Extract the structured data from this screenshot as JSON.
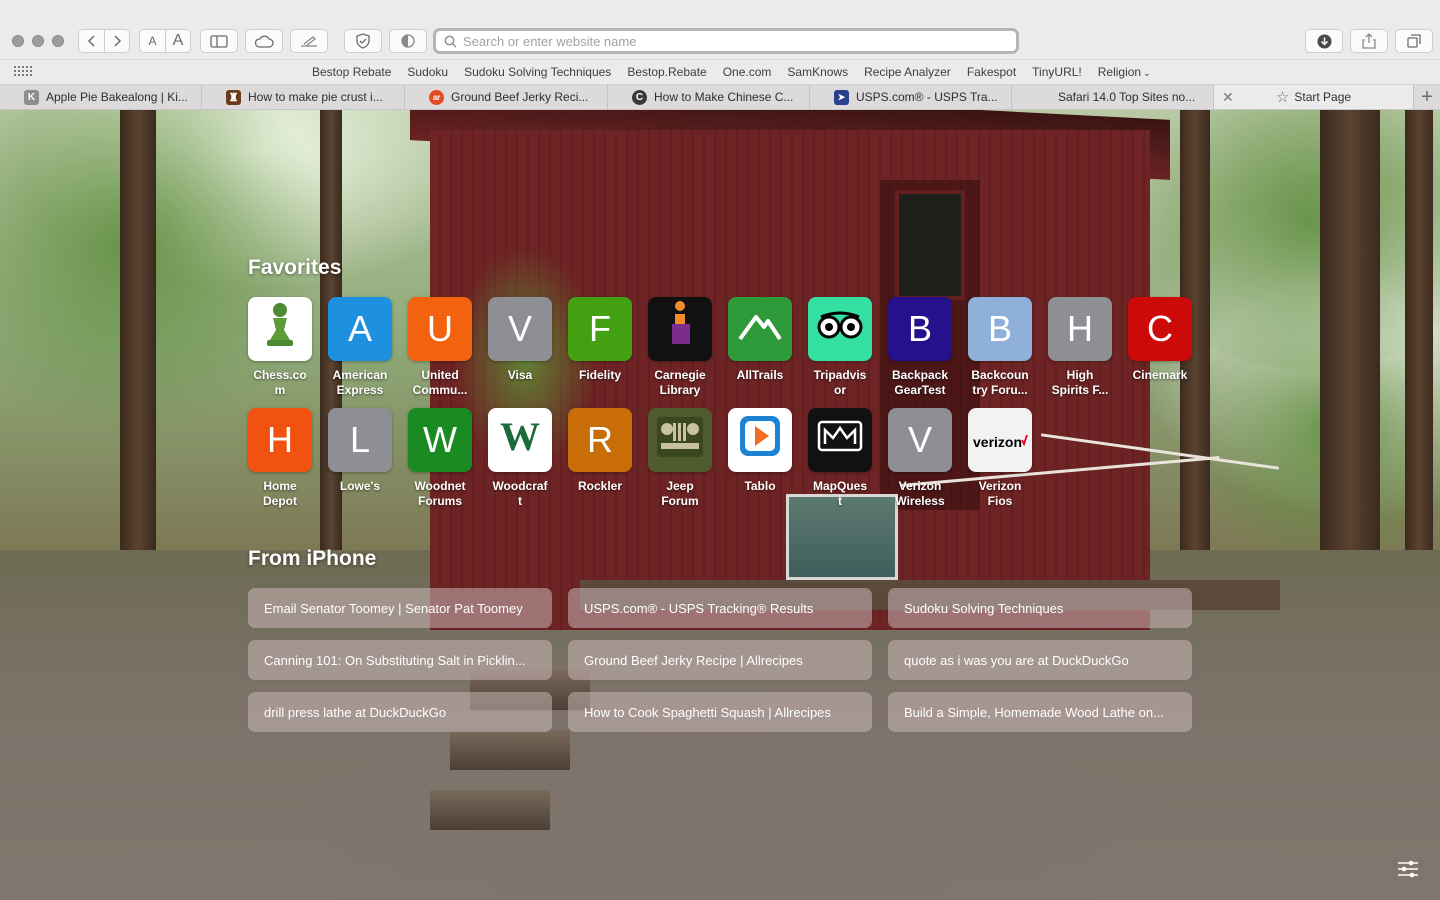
{
  "toolbar": {
    "address": {
      "value": "",
      "placeholder": "Search or enter website name"
    },
    "text_small": "A",
    "text_large": "A"
  },
  "bookmarks": [
    {
      "label": "Bestop Rebate"
    },
    {
      "label": "Sudoku"
    },
    {
      "label": "Sudoku Solving Techniques"
    },
    {
      "label": "Bestop.Rebate"
    },
    {
      "label": "One.com"
    },
    {
      "label": "SamKnows"
    },
    {
      "label": "Recipe Analyzer"
    },
    {
      "label": "Fakespot"
    },
    {
      "label": "TinyURL!"
    },
    {
      "label": "Religion"
    }
  ],
  "tabs": [
    {
      "label": "Apple Pie Bakealong | Ki...",
      "icon": "k-icon",
      "fav_letter": "K",
      "fav_color": "#8f8c8c"
    },
    {
      "label": "How to make pie crust i...",
      "icon": "castle-icon",
      "fav_letter": "",
      "fav_color": "#6b3b1c"
    },
    {
      "label": "Ground Beef Jerky Reci...",
      "icon": "allrecipes-icon",
      "fav_letter": "ar",
      "fav_color": "#e34b21"
    },
    {
      "label": "How to Make Chinese C...",
      "icon": "c-icon",
      "fav_letter": "C",
      "fav_color": "#3a3a3a"
    },
    {
      "label": "USPS.com® - USPS Tra...",
      "icon": "usps-icon",
      "fav_letter": "",
      "fav_color": "#2b3f8c"
    },
    {
      "label": "Safari 14.0 Top Sites no...",
      "icon": "apple-icon",
      "fav_letter": "",
      "fav_color": "#6b6b6b"
    },
    {
      "label": "Start Page",
      "icon": "star-icon",
      "active": true
    }
  ],
  "favorites_title": "Favorites",
  "favorites": [
    {
      "label": "Chess.co\nm",
      "letter": "",
      "color": "#ffffff",
      "icon": "chess-pawn-icon"
    },
    {
      "label": "American\nExpress",
      "letter": "A",
      "color": "#1e90e0"
    },
    {
      "label": "United\nCommu...",
      "letter": "U",
      "color": "#f2620f"
    },
    {
      "label": "Visa",
      "letter": "V",
      "color": "#8e8e95"
    },
    {
      "label": "Fidelity",
      "letter": "F",
      "color": "#43a010"
    },
    {
      "label": "Carnegie\nLibrary",
      "letter": "",
      "color": "#111111",
      "icon": "carnegie-library-icon"
    },
    {
      "label": "AllTrails",
      "letter": "",
      "color": "#2f9a3a",
      "icon": "alltrails-icon"
    },
    {
      "label": "Tripadvis\nor",
      "letter": "",
      "color": "#34e0a1",
      "icon": "tripadvisor-owl-icon"
    },
    {
      "label": "Backpack\nGearTest",
      "letter": "B",
      "color": "#26118c"
    },
    {
      "label": "Backcoun\ntry Foru...",
      "letter": "B",
      "color": "#8fb0d9"
    },
    {
      "label": "High\nSpirits F...",
      "letter": "H",
      "color": "#8e8e95"
    },
    {
      "label": "Cinemark",
      "letter": "C",
      "color": "#cc0a0a"
    },
    {
      "label": "Home\nDepot",
      "letter": "H",
      "color": "#f2520f"
    },
    {
      "label": "Lowe's",
      "letter": "L",
      "color": "#8e8e95"
    },
    {
      "label": "Woodnet\nForums",
      "letter": "W",
      "color": "#1a8a22"
    },
    {
      "label": "Woodcraf\nt",
      "letter": "",
      "color": "#ffffff",
      "icon": "woodcraft-w-icon"
    },
    {
      "label": "Rockler",
      "letter": "R",
      "color": "#c96d09"
    },
    {
      "label": "Jeep\nForum",
      "letter": "",
      "color": "#4f5a2d",
      "icon": "jeep-icon"
    },
    {
      "label": "Tablo",
      "letter": "",
      "color": "#ffffff",
      "icon": "tablo-play-icon"
    },
    {
      "label": "MapQues\nt",
      "letter": "",
      "color": "#111111",
      "icon": "mapquest-icon"
    },
    {
      "label": "Verizon\nWireless",
      "letter": "V",
      "color": "#8e8e95"
    },
    {
      "label": "Verizon\nFios",
      "letter": "",
      "color": "#f2f2f2",
      "icon": "verizon-logo-icon",
      "logo_text": "verizon✓"
    }
  ],
  "from_iphone_title": "From iPhone",
  "from_iphone": [
    {
      "label": "Email Senator Toomey | Senator Pat Toomey"
    },
    {
      "label": "USPS.com® - USPS Tracking® Results"
    },
    {
      "label": "Sudoku Solving Techniques"
    },
    {
      "label": "Canning 101: On Substituting Salt in Picklin..."
    },
    {
      "label": "Ground Beef Jerky Recipe | Allrecipes"
    },
    {
      "label": "quote as i was you are at DuckDuckGo"
    },
    {
      "label": "drill press lathe at DuckDuckGo"
    },
    {
      "label": "How to Cook Spaghetti Squash | Allrecipes"
    },
    {
      "label": "Build a Simple, Homemade Wood Lathe on..."
    }
  ]
}
